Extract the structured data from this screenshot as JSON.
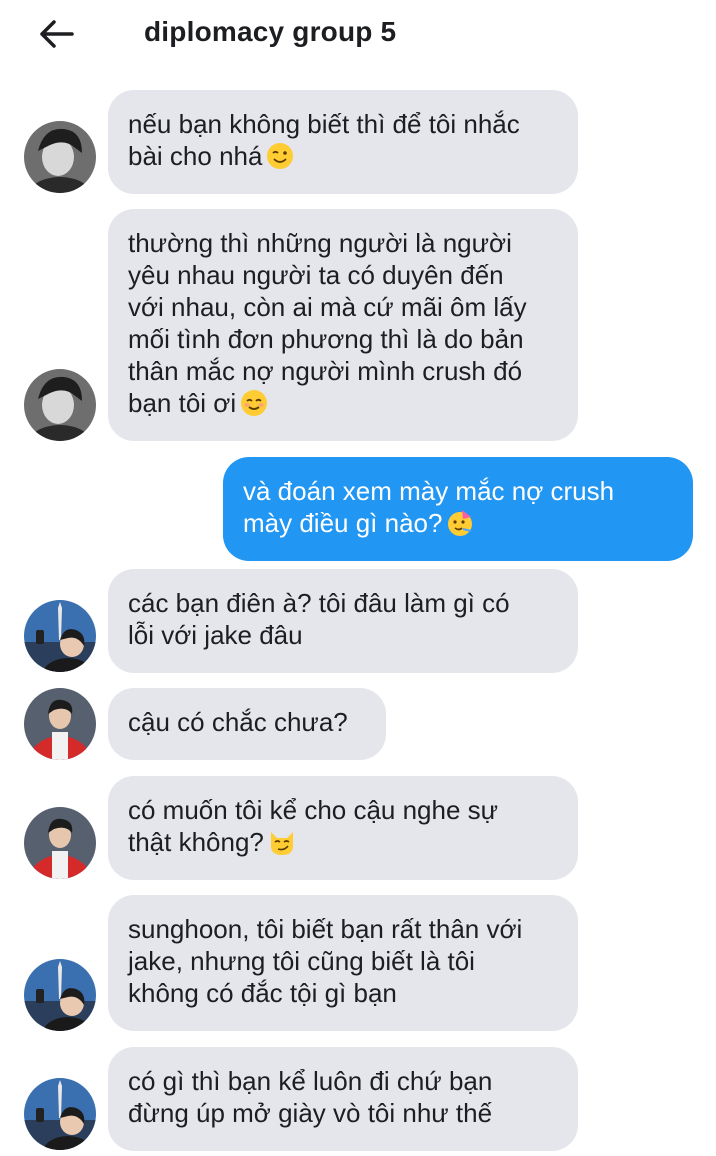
{
  "header": {
    "title": "diplomacy group 5",
    "back_icon": "arrow-left-icon"
  },
  "colors": {
    "incoming_bubble": "#e4e6eb",
    "outgoing_bubble": "#2196f3",
    "outgoing_text": "#ffffff"
  },
  "messages": [
    {
      "direction": "incoming",
      "avatar": "avatar-dark-hair",
      "text": "nếu bạn không biết thì để tôi nhắc\nbài cho nhá",
      "emoji": "winking-face"
    },
    {
      "direction": "incoming",
      "avatar": "avatar-dark-hair",
      "text": "thường thì những người là người\nyêu nhau người ta có duyên đến\nvới nhau, còn ai mà cứ mãi ôm lấy\nmối tình đơn phương thì là do bản\nthân mắc nợ người mình crush đó\nbạn tôi ơi",
      "emoji": "smiling-face"
    },
    {
      "direction": "outgoing",
      "text": "và đoán xem mày mắc nợ crush\nmày điều gì nào?",
      "emoji": "partying-face"
    },
    {
      "direction": "incoming",
      "avatar": "avatar-selfie-tower",
      "text": "các bạn điên à? tôi đâu làm gì có\nlỗi với jake đâu"
    },
    {
      "direction": "incoming",
      "avatar": "avatar-red-jacket",
      "text": "cậu có chắc chưa?"
    },
    {
      "direction": "incoming",
      "avatar": "avatar-red-jacket",
      "text": "có muốn tôi kể cho cậu nghe sự\nthật không?",
      "emoji": "smirking-cat"
    },
    {
      "direction": "incoming",
      "avatar": "avatar-selfie-tower",
      "text": "sunghoon, tôi biết bạn rất thân với\njake, nhưng tôi cũng biết là tôi\nkhông có đắc tội gì bạn"
    },
    {
      "direction": "incoming",
      "avatar": "avatar-selfie-tower",
      "text": "có gì thì bạn kể luôn đi chứ bạn\nđừng úp mở giày vò tôi như thế"
    }
  ]
}
